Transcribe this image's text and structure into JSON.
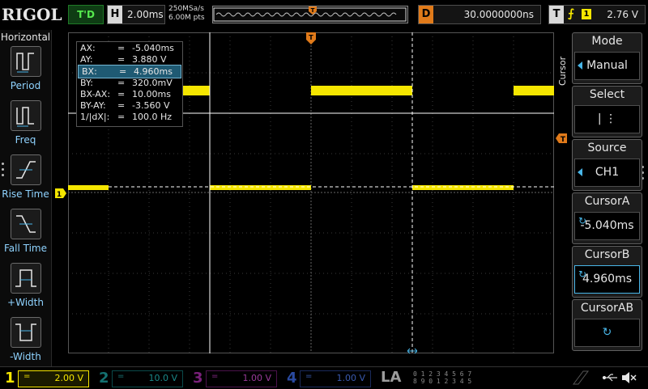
{
  "brand": "RIGOL",
  "run_status": "T'D",
  "horizontal": {
    "key": "H",
    "timebase": "2.00ms",
    "sample_rate": "250MSa/s",
    "memory_depth": "6.00M pts"
  },
  "delay": {
    "key": "D",
    "value": "30.0000000ns"
  },
  "trigger": {
    "key": "T",
    "edge_icon": "rising-edge-icon",
    "source": "1",
    "level": "2.76 V"
  },
  "left_panel": {
    "title": "Horizontal",
    "items": [
      {
        "label": "Period",
        "icon": "period-icon"
      },
      {
        "label": "Freq",
        "icon": "freq-icon"
      },
      {
        "label": "Rise Time",
        "icon": "rise-time-icon"
      },
      {
        "label": "Fall Time",
        "icon": "fall-time-icon"
      },
      {
        "label": "+Width",
        "icon": "pos-width-icon"
      },
      {
        "label": "-Width",
        "icon": "neg-width-icon"
      }
    ]
  },
  "cursor_table": [
    {
      "name": "AX:",
      "value": "-5.040ms"
    },
    {
      "name": "AY:",
      "value": "3.880 V"
    },
    {
      "name": "BX:",
      "value": "4.960ms"
    },
    {
      "name": "BY:",
      "value": "320.0mV"
    },
    {
      "name": "BX-AX:",
      "value": "10.00ms"
    },
    {
      "name": "BY-AY:",
      "value": "-3.560 V"
    },
    {
      "name": "1/|dX|:",
      "value": "100.0 Hz"
    }
  ],
  "cursor_table_eq": "=",
  "menu_title": "Cursor",
  "menu": [
    {
      "title": "Mode",
      "value": "Manual"
    },
    {
      "title": "Select",
      "value": "|   ⋮"
    },
    {
      "title": "Source",
      "value": "CH1"
    },
    {
      "title": "CursorA",
      "value": "-5.040ms"
    },
    {
      "title": "CursorB",
      "value": "4.960ms"
    },
    {
      "title": "CursorAB",
      "value": ""
    }
  ],
  "channels": [
    {
      "num": "1",
      "coupling": "=",
      "scale": "2.00 V",
      "color": "#f5e600",
      "active": true
    },
    {
      "num": "2",
      "coupling": "=",
      "scale": "10.0 V",
      "color": "#00c8c8",
      "active": false
    },
    {
      "num": "3",
      "coupling": "=",
      "scale": "1.00 V",
      "color": "#e040e0",
      "active": false
    },
    {
      "num": "4",
      "coupling": "=",
      "scale": "1.00 V",
      "color": "#3a6cff",
      "active": false
    }
  ],
  "la": {
    "label": "LA",
    "row1": "0 1 2 3  4 5 6 7",
    "row2": "8 9 0 1  2 3 4 5"
  },
  "colors": {
    "ch1": "#f5e600",
    "accent": "#49b6e8",
    "trigger": "#e07a1a"
  }
}
